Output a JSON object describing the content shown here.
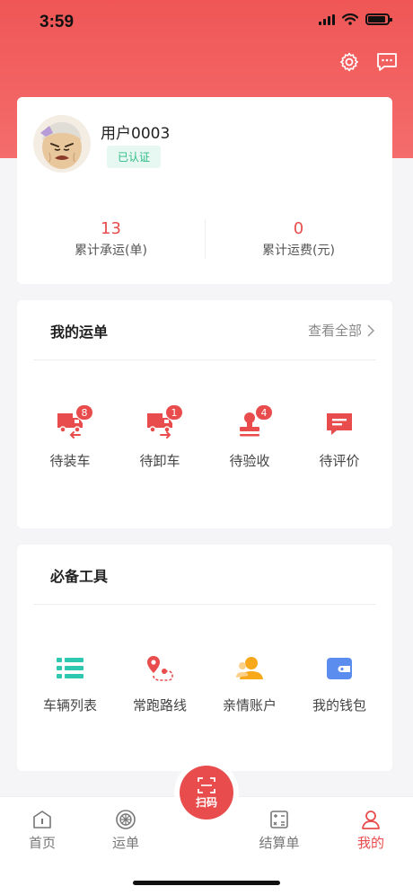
{
  "status_bar": {
    "time": "3:59"
  },
  "header": {
    "icons": [
      "gear-icon",
      "message-icon"
    ]
  },
  "profile": {
    "username": "用户0003",
    "verified_label": "已认证",
    "stats": [
      {
        "value": "13",
        "label": "累计承运(单)"
      },
      {
        "value": "0",
        "label": "累计运费(元)"
      }
    ]
  },
  "orders": {
    "title": "我的运单",
    "view_all": "查看全部",
    "items": [
      {
        "label": "待装车",
        "badge": "8",
        "icon": "truck-load-icon"
      },
      {
        "label": "待卸车",
        "badge": "1",
        "icon": "truck-unload-icon"
      },
      {
        "label": "待验收",
        "badge": "4",
        "icon": "stamp-icon"
      },
      {
        "label": "待评价",
        "icon": "comment-icon"
      }
    ]
  },
  "tools": {
    "title": "必备工具",
    "items": [
      {
        "label": "车辆列表",
        "icon": "list-icon"
      },
      {
        "label": "常跑路线",
        "icon": "route-icon"
      },
      {
        "label": "亲情账户",
        "icon": "family-account-icon"
      },
      {
        "label": "我的钱包",
        "icon": "wallet-icon"
      }
    ]
  },
  "tabbar": {
    "scan_label": "扫码",
    "tabs": [
      {
        "label": "首页"
      },
      {
        "label": "运单"
      },
      {
        "label": "结算单"
      },
      {
        "label": "我的"
      }
    ]
  },
  "colors": {
    "brand": "#e84c4c",
    "verified": "#2dbb86",
    "tool_teal": "#2ec8b0",
    "tool_orange": "#f7a81b",
    "tool_blue": "#5b8def"
  }
}
